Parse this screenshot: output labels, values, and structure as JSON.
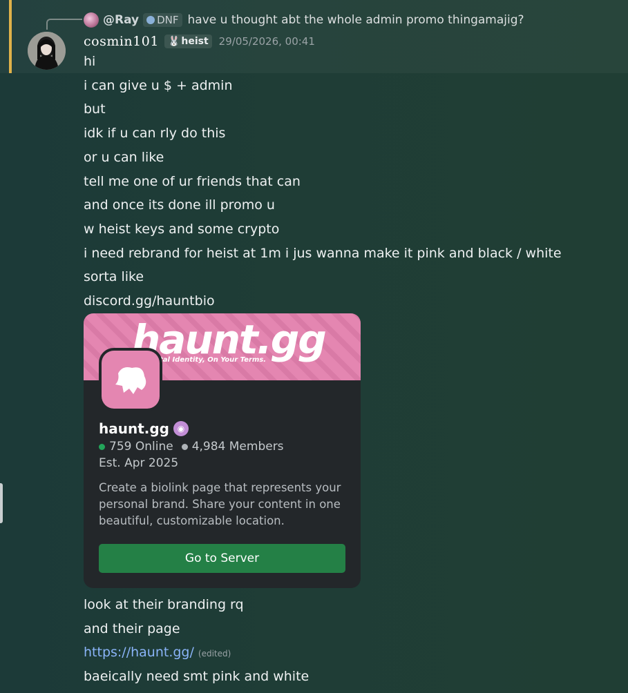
{
  "reply": {
    "mention": "@Ray",
    "tag": "DNF",
    "text": "have u thought abt the whole admin promo thingamajig?"
  },
  "author": {
    "username": "cosmin101",
    "guild_tag": "heist",
    "timestamp": "29/05/2026, 00:41"
  },
  "messages": [
    "hi",
    "i can give u $ + admin",
    "but",
    "idk if u can rly do this",
    "or u can like",
    "tell me one of ur friends that can",
    "and once its done ill promo u",
    "w heist keys and some crypto",
    "i need rebrand for heist at 1m i jus wanna make it pink and black / white",
    "sorta like",
    "discord.gg/hauntbio"
  ],
  "invite": {
    "banner_title": "haunt.gg",
    "banner_subtitle": "tal Identity, On Your Terms.",
    "server_name": "haunt.gg",
    "online": "759 Online",
    "members": "4,984 Members",
    "established": "Est. Apr 2025",
    "description": "Create a biolink page that represents your personal brand. Share your content in one beautiful, customizable location.",
    "button_label": "Go to Server"
  },
  "after_messages": {
    "m1": "look at their branding rq",
    "m2": "and their page",
    "link": "https://haunt.gg/",
    "edited": "(edited)",
    "m4": "baeically need smt pink and white"
  },
  "colors": {
    "accent_highlight": "#e0b24a",
    "link": "#8ab4f8",
    "banner_pink": "#e486b1",
    "button_green": "#248046",
    "online_green": "#23a55a"
  }
}
